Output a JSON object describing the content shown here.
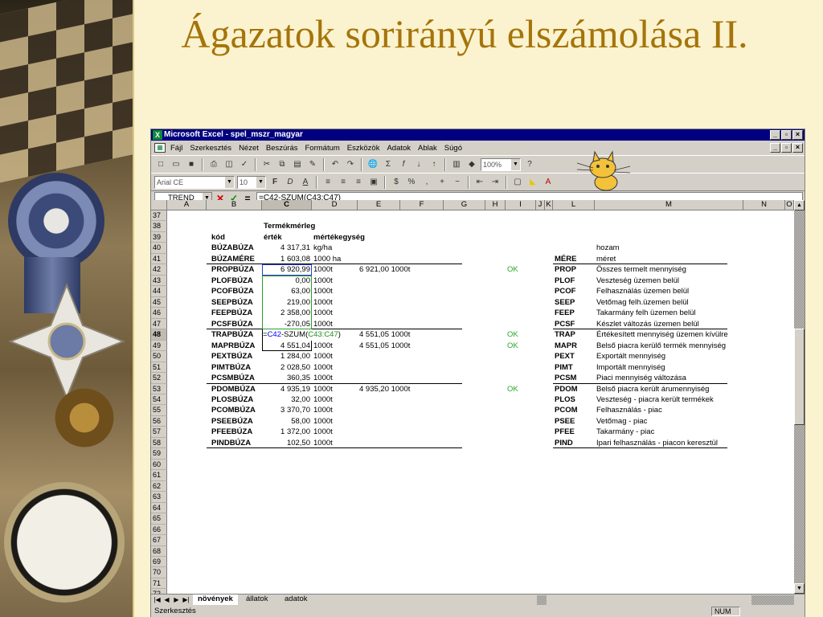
{
  "slide": {
    "title": "Ágazatok sorirányú elszámolása II."
  },
  "window": {
    "title": "Microsoft Excel - spel_mszr_magyar",
    "menu": [
      "Fájl",
      "Szerkesztés",
      "Nézet",
      "Beszúrás",
      "Formátum",
      "Eszközök",
      "Adatok",
      "Ablak",
      "Súgó"
    ],
    "zoom": "100%",
    "font_name": "Arial CE",
    "font_size": "10"
  },
  "formula_bar": {
    "name_box": "TREND",
    "formula": "=C42-SZUM(C43:C47)"
  },
  "columns": [
    "A",
    "B",
    "C",
    "D",
    "E",
    "F",
    "G",
    "H",
    "I",
    "J",
    "K",
    "L",
    "M",
    "N",
    "O"
  ],
  "rows": [
    {
      "n": "37"
    },
    {
      "n": "38",
      "C": "Termékmérleg"
    },
    {
      "n": "39",
      "B": "kód",
      "C": "érték",
      "D": "mértékegység"
    },
    {
      "n": "40",
      "B": "BÚZABÚZA",
      "C": "4 317,31",
      "D": "kg/ha",
      "M": "hozam"
    },
    {
      "n": "41",
      "B": "BÚZAMÉRE",
      "C": "1 603,08",
      "D": "1000 ha",
      "L": "MÉRE",
      "M": "méret"
    },
    {
      "n": "42",
      "B": "PROPBÚZA",
      "C": "6 920,99",
      "D": "1000t",
      "E": "6 921,00 1000t",
      "I": "OK",
      "L": "PROP",
      "M": "Összes termelt mennyiség"
    },
    {
      "n": "43",
      "B": "PLOFBÚZA",
      "C": "0,00",
      "D": "1000t",
      "L": "PLOF",
      "M": "Veszteség üzemen belül"
    },
    {
      "n": "44",
      "B": "PCOFBÚZA",
      "C": "63,00",
      "D": "1000t",
      "L": "PCOF",
      "M": "Felhasználás üzemen belül"
    },
    {
      "n": "45",
      "B": "SEEPBÚZA",
      "C": "219,00",
      "D": "1000t",
      "L": "SEEP",
      "M": "Vetőmag felh.üzemen belül"
    },
    {
      "n": "46",
      "B": "FEEPBÚZA",
      "C": "2 358,00",
      "D": "1000t",
      "L": "FEEP",
      "M": "Takarmány felh üzemen belül"
    },
    {
      "n": "47",
      "B": "PCSFBÚZA",
      "C": "-270,05",
      "D": "1000t",
      "L": "PCSF",
      "M": "Készlet változás üzemen belül"
    },
    {
      "n": "48",
      "B": "TRAPBÚZA",
      "C_formula": {
        "p1": "=",
        "p2": "C42",
        "p3": "-SZUM(",
        "p4": "C43:C47",
        "p5": ")"
      },
      "E": "4 551,05 1000t",
      "I": "OK",
      "L": "TRAP",
      "M": "Értékesített mennyiség üzemen kívülre"
    },
    {
      "n": "49",
      "B": "MAPRBÚZA",
      "C": "4 551,04",
      "D": "1000t",
      "E": "4 551,05 1000t",
      "I": "OK",
      "L": "MAPR",
      "M": "Belső piacra kerülő termék mennyiség"
    },
    {
      "n": "50",
      "B": "PEXTBÚZA",
      "C": "1 284,00",
      "D": "1000t",
      "L": "PEXT",
      "M": "Exportált mennyiség"
    },
    {
      "n": "51",
      "B": "PIMTBÚZA",
      "C": "2 028,50",
      "D": "1000t",
      "L": "PIMT",
      "M": "Importált mennyiség"
    },
    {
      "n": "52",
      "B": "PCSMBÚZA",
      "C": "360,35",
      "D": "1000t",
      "L": "PCSM",
      "M": "Piaci mennyiség változása"
    },
    {
      "n": "53",
      "B": "PDOMBÚZA",
      "C": "4 935,19",
      "D": "1000t",
      "E": "4 935,20 1000t",
      "I": "OK",
      "L": "PDOM",
      "M": "Belső piacra került árumennyiség"
    },
    {
      "n": "54",
      "B": "PLOSBÚZA",
      "C": "32,00",
      "D": "1000t",
      "L": "PLOS",
      "M": "Veszteség - piacra került termékek"
    },
    {
      "n": "55",
      "B": "PCOMBÚZA",
      "C": "3 370,70",
      "D": "1000t",
      "L": "PCOM",
      "M": "Felhasználás - piac"
    },
    {
      "n": "56",
      "B": "PSEEBÚZA",
      "C": "58,00",
      "D": "1000t",
      "L": "PSEE",
      "M": "Vetőmag - piac"
    },
    {
      "n": "57",
      "B": "PFEEBÚZA",
      "C": "1 372,00",
      "D": "1000t",
      "L": "PFEE",
      "M": "Takarmány - piac"
    },
    {
      "n": "58",
      "B": "PINDBÚZA",
      "C": "102,50",
      "D": "1000t",
      "L": "PIND",
      "M": "Ipari felhasználás - piacon keresztül"
    },
    {
      "n": "59"
    },
    {
      "n": "60"
    },
    {
      "n": "61"
    },
    {
      "n": "62"
    },
    {
      "n": "63"
    },
    {
      "n": "64"
    },
    {
      "n": "65"
    },
    {
      "n": "66"
    },
    {
      "n": "67"
    },
    {
      "n": "68"
    },
    {
      "n": "69"
    },
    {
      "n": "70"
    },
    {
      "n": "71"
    },
    {
      "n": "72"
    }
  ],
  "sheets": [
    "növények",
    "állatok",
    "adatok"
  ],
  "status": {
    "mode": "Szerkesztés",
    "num": "NUM"
  }
}
